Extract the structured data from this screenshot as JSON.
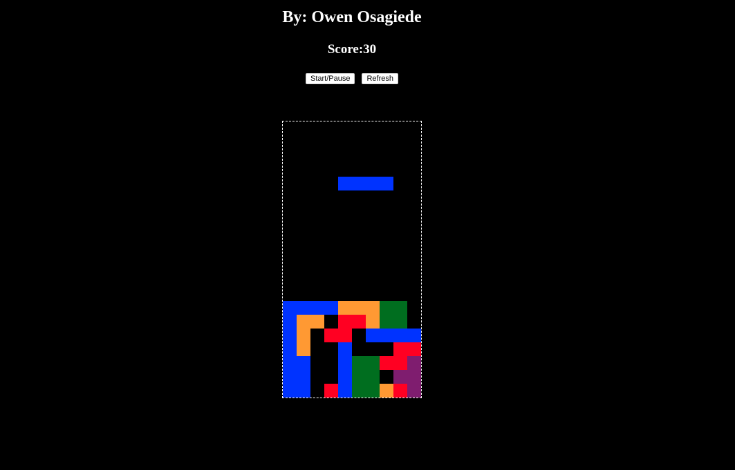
{
  "header": {
    "author": "By: Owen Osagiede",
    "score_label": "Score:",
    "score_value": "30"
  },
  "controls": {
    "start_pause_label": "Start/Pause",
    "refresh_label": "Refresh"
  },
  "colors": {
    "background": "#000000",
    "blue": "#0033ff",
    "orange": "#ff9933",
    "green": "#006e1f",
    "red": "#ff0022",
    "purple": "#7f1d6f"
  },
  "board": {
    "columns": 10,
    "rows": 20,
    "active_piece": {
      "type": "I",
      "color": "#0033ff",
      "cells": [
        [
          4,
          4
        ],
        [
          5,
          4
        ],
        [
          6,
          4
        ],
        [
          7,
          4
        ]
      ]
    },
    "grid": [
      "..........",
      "..........",
      "..........",
      "..........",
      "..........",
      "..........",
      "..........",
      "..........",
      "..........",
      "..........",
      "..........",
      "..........",
      "..........",
      "BBBBOOOGG.",
      "BOO.RROGG.",
      "BO.RR.BBBB",
      "BO..B...RR",
      "BB..BGGRRP",
      "BB..BGG.PP",
      "BB.RBGGORP"
    ],
    "legend": {
      "B": "#0033ff",
      "O": "#ff9933",
      "G": "#006e1f",
      "R": "#ff0022",
      "P": "#7f1d6f"
    }
  }
}
